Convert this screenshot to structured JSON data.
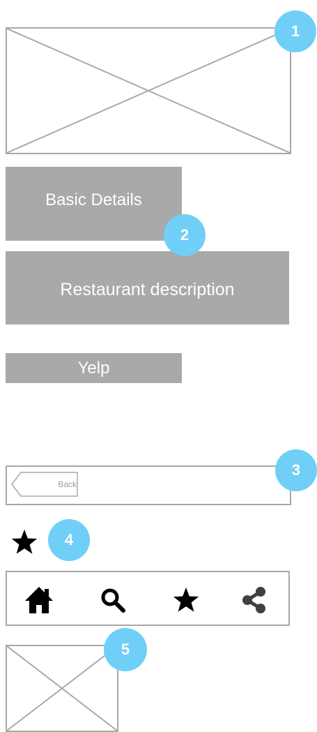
{
  "callouts": [
    "1",
    "2",
    "3",
    "4",
    "5"
  ],
  "details": {
    "basic_label": "Basic Details",
    "description_label": "Restaurant description",
    "yelp_label": "Yelp"
  },
  "navbar": {
    "back_label": "Back"
  },
  "tabbar": {
    "icons": [
      "home-icon",
      "search-icon",
      "star-icon",
      "share-icon"
    ]
  },
  "colors": {
    "callout": "#6fcff7",
    "block": "#a9a9a9",
    "outline": "#a8a8a8"
  }
}
